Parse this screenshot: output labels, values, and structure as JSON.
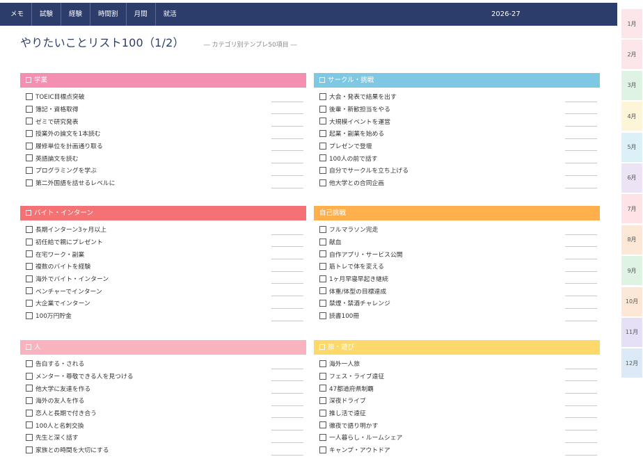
{
  "nav": {
    "items": [
      "メモ",
      "試験",
      "経験",
      "時間割",
      "月間",
      "就活"
    ],
    "year": "2026-27"
  },
  "header": {
    "title": "やりたいことリスト100（1/2）",
    "subtitle": "― カテゴリ別テンプレ50項目 ―"
  },
  "month_tabs": [
    {
      "label": "1月",
      "color": "#fde6ea"
    },
    {
      "label": "2月",
      "color": "#fde6ea"
    },
    {
      "label": "3月",
      "color": "#dff3e4"
    },
    {
      "label": "4月",
      "color": "#fdf5d8"
    },
    {
      "label": "5月",
      "color": "#dcf0f8"
    },
    {
      "label": "6月",
      "color": "#ece4f5"
    },
    {
      "label": "7月",
      "color": "#fde3e6"
    },
    {
      "label": "8月",
      "color": "#fde8d8"
    },
    {
      "label": "9月",
      "color": "#dff3e4"
    },
    {
      "label": "10月",
      "color": "#fde8d8"
    },
    {
      "label": "11月",
      "color": "#e6e0f7"
    },
    {
      "label": "12月",
      "color": "#dceaf8"
    }
  ],
  "sections": [
    {
      "title": "学業",
      "color": "#f48fb1",
      "checkbox_mark": true,
      "items": [
        "TOEIC目標点突破",
        "簿記・資格取得",
        "ゼミで研究発表",
        "授業外の論文を1本読む",
        "履修単位を計画通り取る",
        "英語論文を読む",
        "プログラミングを学ぶ",
        "第二外国語を話せるレベルに"
      ]
    },
    {
      "title": "サークル・挑戦",
      "color": "#7ec8e3",
      "checkbox_mark": true,
      "items": [
        "大会・発表で結果を出す",
        "後輩・新歓担当をやる",
        "大規模イベントを運営",
        "起業・副業を始める",
        "プレゼンで登壇",
        "100人の前で話す",
        "自分でサークルを立ち上げる",
        "他大学との合同企画"
      ]
    },
    {
      "title": "バイト・インターン",
      "color": "#f47174",
      "checkbox_mark": true,
      "items": [
        "長期インターン3ヶ月以上",
        "初任給で親にプレゼント",
        "在宅ワーク・副業",
        "複数のバイトを経験",
        "海外でバイト・インターン",
        "ベンチャーでインターン",
        "大企業でインターン",
        "100万円貯金"
      ]
    },
    {
      "title": "自己挑戦",
      "color": "#ffb04c",
      "checkbox_mark": false,
      "items": [
        "フルマラソン完走",
        "献血",
        "自作アプリ・サービス公開",
        "筋トレで体を変える",
        "1ヶ月早寝早起き継続",
        "体重/体型の目標達成",
        "禁煙・禁酒チャレンジ",
        "読書100冊"
      ]
    },
    {
      "title": "人",
      "color": "#f9b3bf",
      "checkbox_mark": true,
      "items": [
        "告白する・される",
        "メンター・尊敬できる人を見つける",
        "他大学に友達を作る",
        "海外の友人を作る",
        "恋人と長期で付き合う",
        "100人と名刺交換",
        "先生と深く話す",
        "家族との時間を大切にする"
      ]
    },
    {
      "title": "旅・遊び",
      "color": "#fcd96a",
      "checkbox_mark": true,
      "items": [
        "海外一人旅",
        "フェス・ライブ遠征",
        "47都道府県制覇",
        "深夜ドライブ",
        "推し活で遠征",
        "徹夜で語り明かす",
        "一人暮らし・ルームシェア",
        "キャンプ・アウトドア"
      ]
    }
  ]
}
